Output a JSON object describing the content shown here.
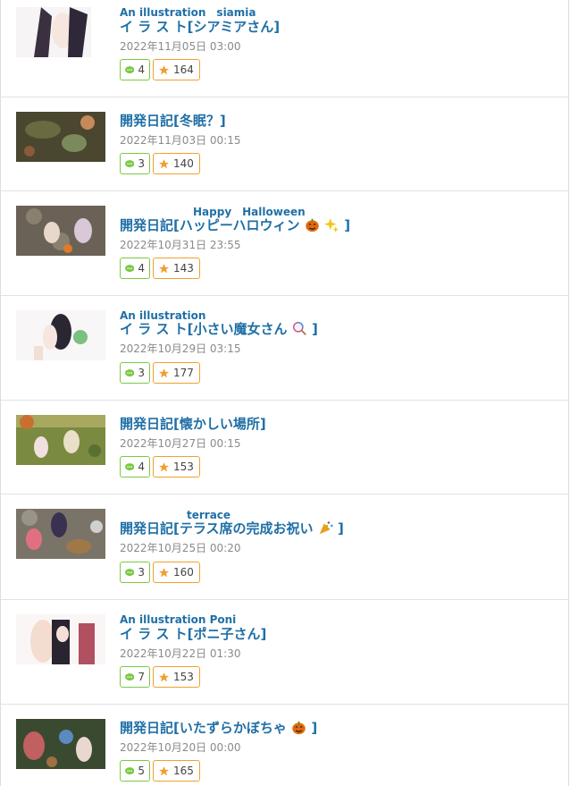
{
  "entries": [
    {
      "ruby": "An illustration　siamia",
      "title": "イ ラ ス ト[シアミアさん]",
      "date": "2022年11月05日 03:00",
      "comments": "4",
      "favs": "164",
      "emoji": ""
    },
    {
      "ruby": "",
      "title": "開発日記[冬眠？]",
      "date": "2022年11月03日 00:15",
      "comments": "3",
      "favs": "140",
      "emoji": ""
    },
    {
      "ruby": "Happy　Halloween",
      "title": "開発日記[ハッピーハロウィン",
      "title_end": "]",
      "date": "2022年10月31日 23:55",
      "comments": "4",
      "favs": "143",
      "emoji": "pumpkin-sparkle"
    },
    {
      "ruby": "An illustration",
      "title": "イ ラ ス ト[小さい魔女さん",
      "title_end": "]",
      "date": "2022年10月29日 03:15",
      "comments": "3",
      "favs": "177",
      "emoji": "lollipop"
    },
    {
      "ruby": "",
      "title": "開発日記[懐かしい場所]",
      "date": "2022年10月27日 00:15",
      "comments": "4",
      "favs": "153",
      "emoji": ""
    },
    {
      "ruby": "terrace",
      "title": "開発日記[テラス席の完成お祝い",
      "title_end": "]",
      "date": "2022年10月25日 00:20",
      "comments": "3",
      "favs": "160",
      "emoji": "party-popper"
    },
    {
      "ruby": "An illustration Poni",
      "title": "イ ラ ス ト[ポニ子さん]",
      "date": "2022年10月22日 01:30",
      "comments": "7",
      "favs": "153",
      "emoji": ""
    },
    {
      "ruby": "",
      "title": "開発日記[いたずらかぼちゃ",
      "title_end": "]",
      "date": "2022年10月20日 00:00",
      "comments": "5",
      "favs": "165",
      "emoji": "pumpkin"
    }
  ],
  "colors": {
    "link": "#1f6fa6",
    "comment_border": "#7ac943",
    "fav_border": "#f0a030",
    "date": "#8a8a8a"
  }
}
